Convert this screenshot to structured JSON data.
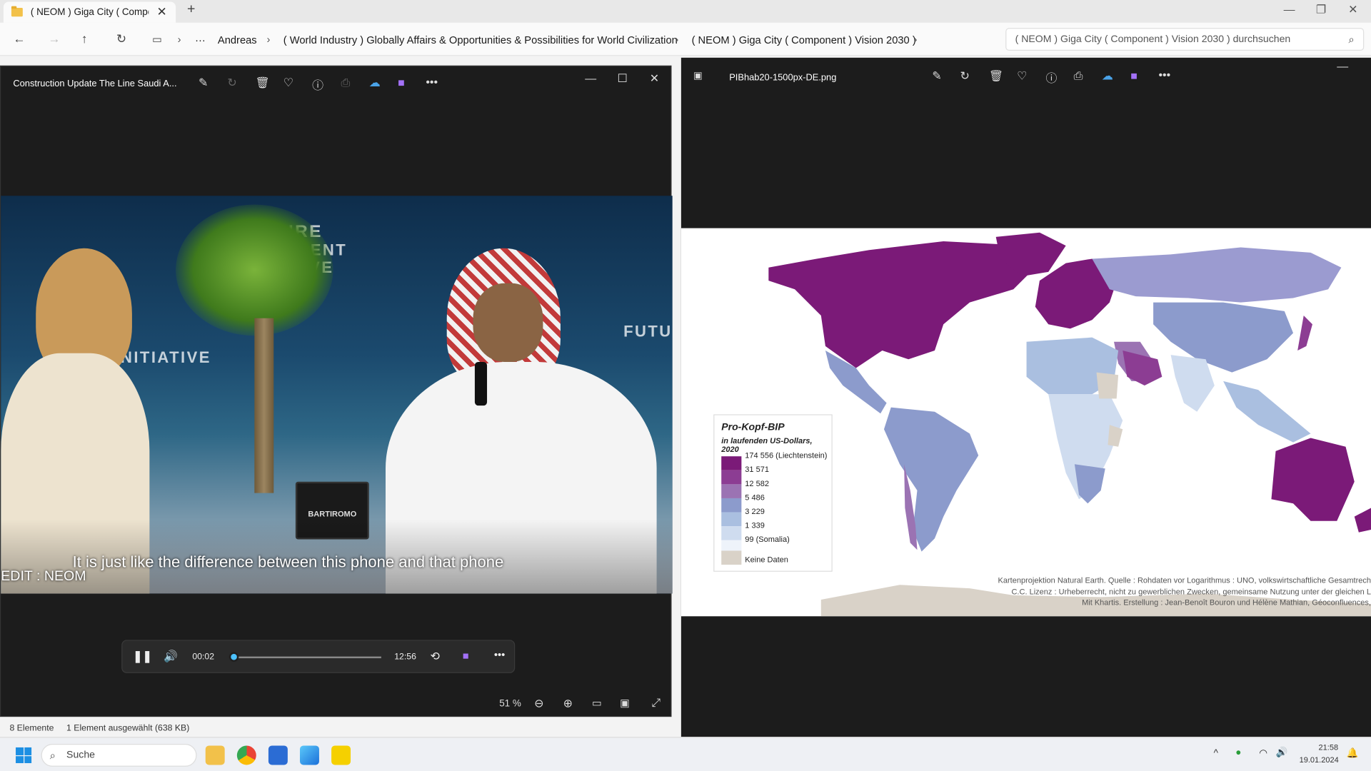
{
  "explorer": {
    "tab_title": "( NEOM ) Giga City ( Compone",
    "new_tab": "+",
    "breadcrumb": [
      "Andreas",
      "( World Industry ) Globally Affairs & Opportunities & Possibilities for World Civilization",
      "( NEOM ) Giga City ( Component ) Vision 2030 )"
    ],
    "more": "···",
    "search_placeholder": "( NEOM ) Giga City ( Component ) Vision 2030 ) durchsuchen",
    "status_count": "8 Elemente",
    "status_selected": "1 Element ausgewählt (638 KB)"
  },
  "video_player": {
    "title": "Construction Update The Line  Saudi A...",
    "subtitle": "It is just like the difference  between this phone and that phone",
    "credit": "EDIT : NEOM",
    "sign": "BARTIROMO",
    "wall_text": [
      "FUTURE",
      "INVESTMENT",
      "INITIATIVE"
    ],
    "time_current": "00:02",
    "time_total": "12:56",
    "progress": 0.003,
    "zoom": "51 %"
  },
  "image_viewer": {
    "filename": "PIBhab20-1500px-DE.png",
    "legend_title": "Pro-Kopf-BIP",
    "legend_subtitle": "in laufenden US-Dollars, 2020",
    "legend_items": [
      {
        "label": "174 556 (Liechtenstein)",
        "color": "#7b1a78"
      },
      {
        "label": "31 571",
        "color": "#8c3d93"
      },
      {
        "label": "12 582",
        "color": "#9b73b3"
      },
      {
        "label": "5 486",
        "color": "#8c9bcc"
      },
      {
        "label": "3 229",
        "color": "#aabfe0"
      },
      {
        "label": "1 339",
        "color": "#cfdcef"
      },
      {
        "label": "99 (Somalia)",
        "color": "#eef3fa"
      }
    ],
    "no_data_label": "Keine Daten",
    "no_data_color": "#d9d2c8",
    "credits": [
      "Kartenprojektion Natural Earth. Quelle : Rohdaten vor Logarithmus : UNO,  volkswirtschaftliche Gesamtrech",
      "C.C. Lizenz : Urheberrecht, nicht zu gewerblichen Zwecken, gemeinsame Nutzung unter der gleichen L",
      "Mit Khartis. Erstellung : Jean-Benoît Bouron und Hélène Mathian, Géoconfluences,"
    ]
  },
  "taskbar": {
    "search": "Suche",
    "time": "21:58",
    "date": "19.01.2024"
  }
}
